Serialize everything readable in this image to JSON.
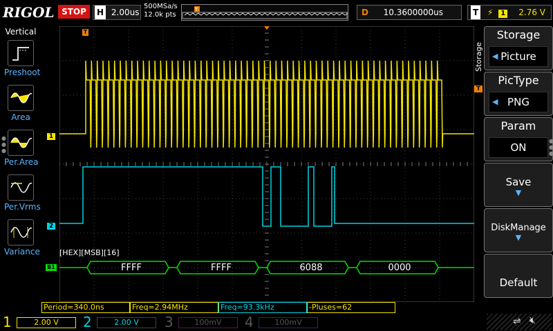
{
  "header": {
    "brand": "RIGOL",
    "run_state": "STOP",
    "timebase_label": "H",
    "timebase_value": "2.00us",
    "sample_rate": "500MSa/s",
    "memory_depth": "12.0k pts",
    "delay_label": "D",
    "delay_value": "10.3600000us",
    "trigger_label": "T",
    "trigger_source": "1",
    "trigger_level": "2.76 V"
  },
  "left_menu": {
    "title": "Vertical",
    "items": [
      {
        "label": "Preshoot",
        "icon": "preshoot-icon"
      },
      {
        "label": "Area",
        "icon": "area-icon"
      },
      {
        "label": "Per.Area",
        "icon": "per-area-icon"
      },
      {
        "label": "Per.Vrms",
        "icon": "per-vrms-icon"
      },
      {
        "label": "Variance",
        "icon": "variance-icon"
      }
    ]
  },
  "right_menu": {
    "side_title": "Storage",
    "storage_label": "Storage",
    "storage_value": "Picture",
    "pictype_label": "PicType",
    "pictype_value": "PNG",
    "param_label": "Param",
    "param_value": "ON",
    "save_label": "Save",
    "diskmanage_label": "DiskManage",
    "default_label": "Default"
  },
  "waveform": {
    "ch1_marker": "1",
    "ch2_marker": "2",
    "bus_marker": "B1",
    "trigger_marker": "T",
    "decode_format": "[HEX][MSB][16]",
    "decode_values": [
      "FFFF",
      "FFFF",
      "6088",
      "0000"
    ],
    "ch1_color": "#f5e400",
    "ch2_color": "#00d6e6",
    "bus_color": "#00e000"
  },
  "measurements": [
    {
      "label": "Period=340.0ns",
      "color": "#f5e400"
    },
    {
      "label": "Freq=2.94MHz",
      "color": "#f5e400"
    },
    {
      "label": "Freq=93.3kHz",
      "color": "#00d6e6"
    },
    {
      "label": "-Pluses=62",
      "color": "#f5e400"
    }
  ],
  "channels": [
    {
      "num": "1",
      "scale": "2.00 V",
      "color": "#f5e400"
    },
    {
      "num": "2",
      "scale": "2.00 V",
      "color": "#00d6e6"
    },
    {
      "num": "3",
      "scale": "100mV",
      "color": "#c040c0"
    },
    {
      "num": "4",
      "scale": "100mV",
      "color": "#4070ff"
    }
  ]
}
